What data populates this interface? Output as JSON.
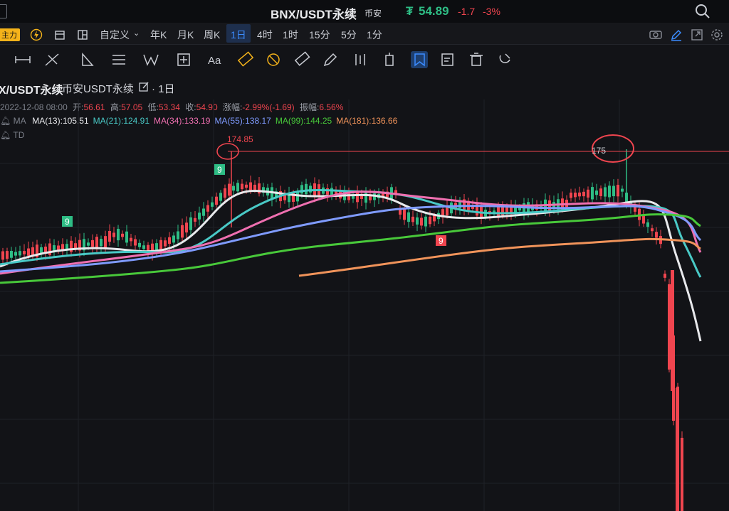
{
  "header": {
    "title": "BNX/USDT永续",
    "exchange": "币安",
    "price_icon": "₮",
    "price": "54.89",
    "change": "-1.7",
    "change_pct": "-3%"
  },
  "timeframes": {
    "zhuli": "主力",
    "custom": "自定义",
    "items": [
      "年K",
      "月K",
      "周K",
      "1日",
      "4时",
      "1时",
      "15分",
      "5分",
      "1分"
    ],
    "active": "1日"
  },
  "symbol_bar": {
    "symbol": "X/USDT永续",
    "exchange_name": "币安USDT永续",
    "interval": "· 1日"
  },
  "ohlc": {
    "date": "2022-12-08 08:00",
    "open_label": "开:",
    "open": "56.61",
    "high_label": "高:",
    "high": "57.05",
    "low_label": "低:",
    "low": "53.34",
    "close_label": "收:",
    "close": "54.90",
    "chg_label": "涨幅:",
    "chg": "-2.99%(-1.69)",
    "amp_label": "振幅:",
    "amp": "6.56%"
  },
  "ma": {
    "label": "MA",
    "items": [
      {
        "text": "MA(13):105.51",
        "color": "#e8e9ec"
      },
      {
        "text": "MA(21):124.91",
        "color": "#49c9c6"
      },
      {
        "text": "MA(34):133.19",
        "color": "#ef6fb0"
      },
      {
        "text": "MA(55):138.17",
        "color": "#7f9bff"
      },
      {
        "text": "MA(99):144.25",
        "color": "#48c83a"
      },
      {
        "text": "MA(181):136.66",
        "color": "#f0935a"
      }
    ]
  },
  "td_label": "TD",
  "annotations": {
    "high_left": "174.85",
    "high_right": "175",
    "td9_a": "9",
    "td9_b": "9",
    "td9_c": "9"
  },
  "colors": {
    "up": "#2ebd85",
    "down": "#f0454f",
    "accent": "#3b8cff"
  },
  "toolbar_icons": [
    "horizontal-line-icon",
    "segment-icon",
    "channel-icon",
    "triangle-icon",
    "parallel-lines-icon",
    "w-pattern-icon",
    "plus-box-icon",
    "text-icon",
    "ruler-icon",
    "fib-icon",
    "measure-icon",
    "pen-icon",
    "bars-icon",
    "price-range-icon",
    "bookmark-icon",
    "note-icon",
    "trash-icon",
    "magnet-icon"
  ]
}
